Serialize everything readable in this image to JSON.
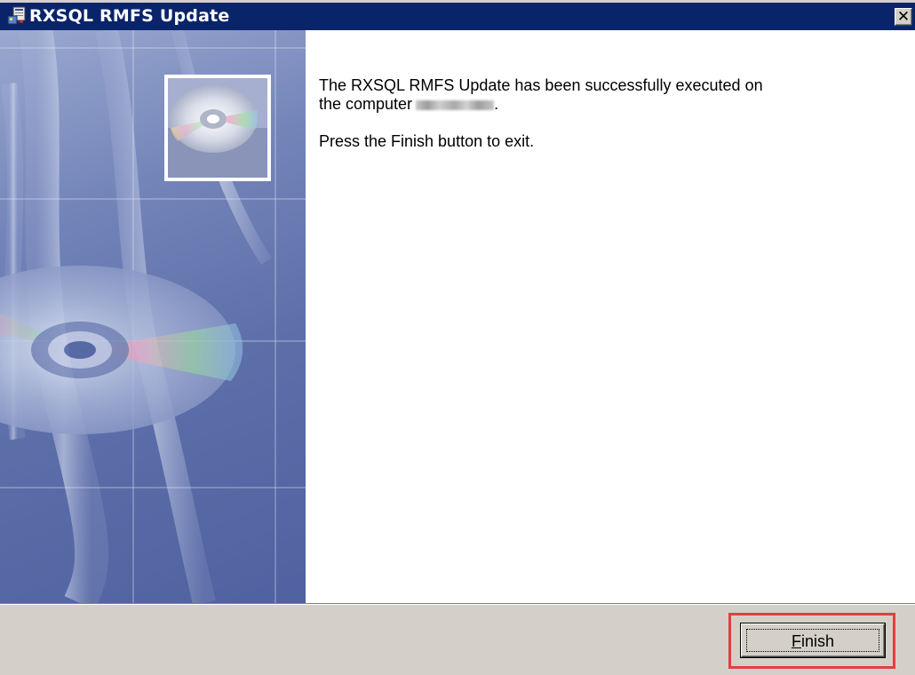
{
  "window": {
    "title": "RXSQL RMFS Update",
    "close_glyph": "✕",
    "icon": "installer-icon"
  },
  "banner": {
    "image": "cd-disc-banner-image",
    "badge": "cd-disc-icon"
  },
  "content": {
    "message_line1": "The RXSQL RMFS Update has been successfully executed on",
    "message_line2_prefix": "the computer",
    "message_line2_suffix": ".",
    "message_exit": "Press the Finish button to exit."
  },
  "buttons": {
    "finish_mnemonic": "F",
    "finish_rest": "inish"
  },
  "colors": {
    "titlebar": "#0a246a",
    "face": "#d4d0c8",
    "highlight": "#e04040"
  }
}
